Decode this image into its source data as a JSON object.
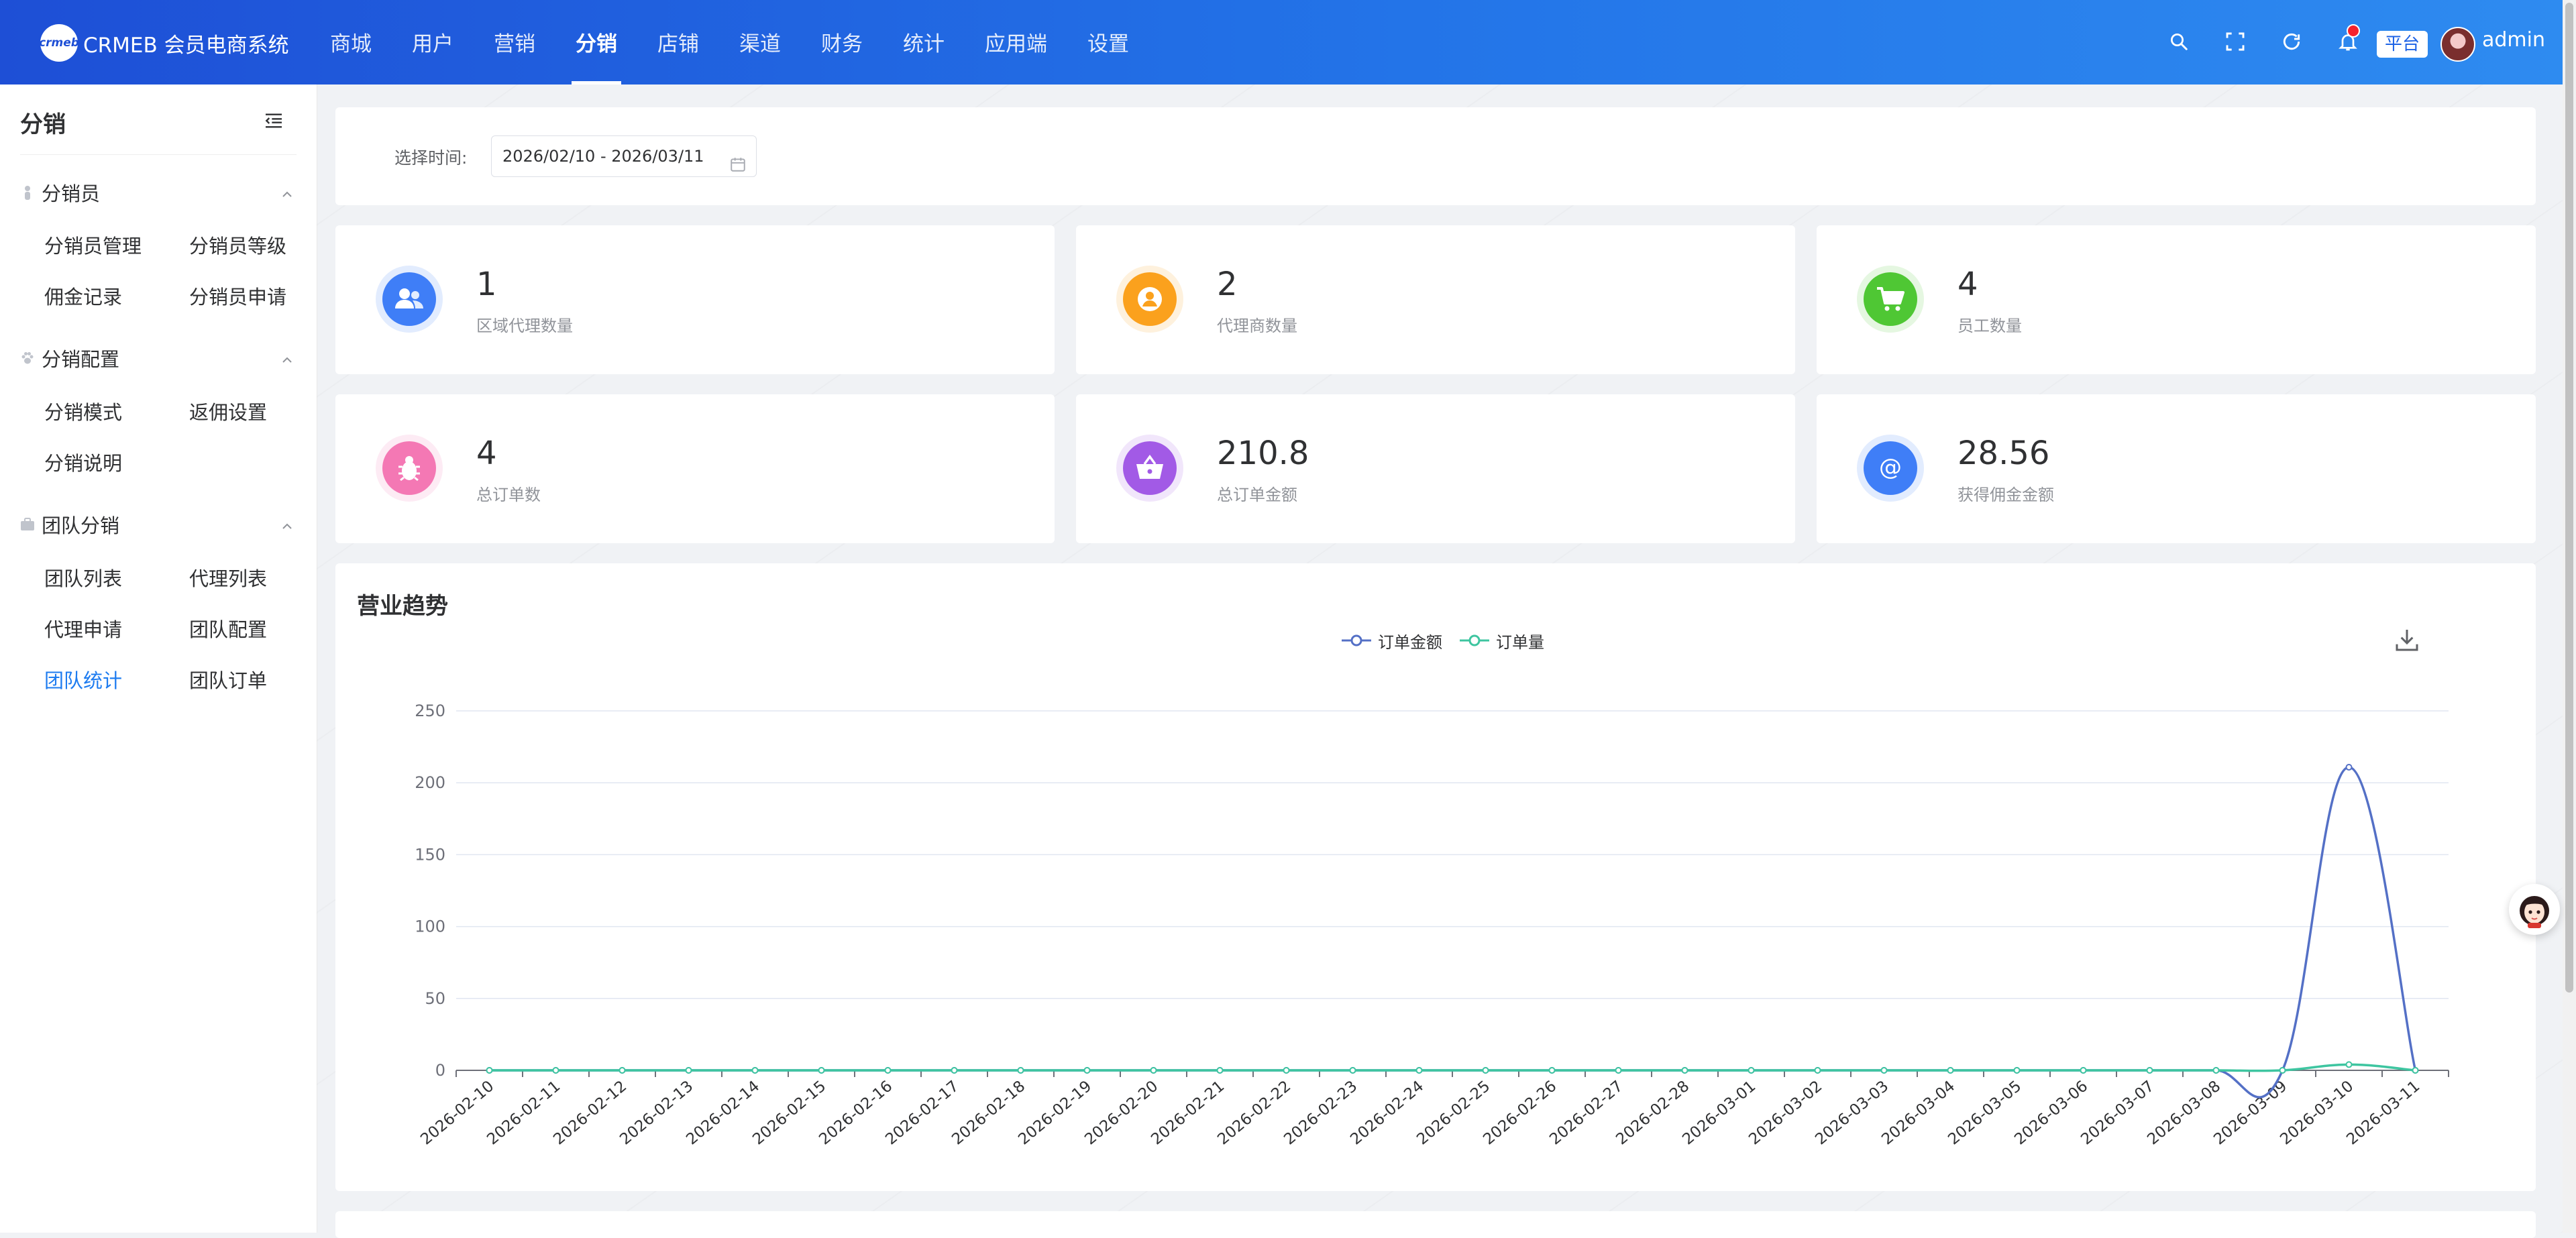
{
  "app": {
    "logo_text": "crmeb",
    "title": "CRMEB 会员电商系统"
  },
  "nav": {
    "items": [
      {
        "label": "商城"
      },
      {
        "label": "用户"
      },
      {
        "label": "营销"
      },
      {
        "label": "分销",
        "active": true
      },
      {
        "label": "店铺"
      },
      {
        "label": "渠道"
      },
      {
        "label": "财务"
      },
      {
        "label": "统计"
      },
      {
        "label": "应用端"
      },
      {
        "label": "设置"
      }
    ],
    "platform_tag": "平台",
    "username": "admin",
    "icons": [
      "search-icon",
      "fullscreen-icon",
      "refresh-icon",
      "bell-icon"
    ],
    "notification_dot_color": "#f5222d"
  },
  "sidebar": {
    "title": "分销",
    "groups": [
      {
        "label": "分销员",
        "icon": "user-icon",
        "items": [
          "分销员管理",
          "分销员等级",
          "佣金记录",
          "分销员申请"
        ]
      },
      {
        "label": "分销配置",
        "icon": "paw-icon",
        "items": [
          "分销模式",
          "返佣设置",
          "分销说明"
        ]
      },
      {
        "label": "团队分销",
        "icon": "briefcase-icon",
        "items": [
          "团队列表",
          "代理列表",
          "代理申请",
          "团队配置",
          "团队统计",
          "团队订单"
        ]
      }
    ],
    "active_item": "团队统计",
    "accent_color": "#1e7cf0"
  },
  "filter": {
    "label": "选择时间:",
    "date_range": "2026/02/10 - 2026/03/11"
  },
  "stats": [
    {
      "value": "1",
      "label": "区域代理数量",
      "color": "#3f7ef7",
      "icon": "users-icon"
    },
    {
      "value": "2",
      "label": "代理商数量",
      "color": "#fba11d",
      "icon": "person-icon"
    },
    {
      "value": "4",
      "label": "员工数量",
      "color": "#4fc734",
      "icon": "cart-icon"
    },
    {
      "value": "4",
      "label": "总订单数",
      "color": "#f478b4",
      "icon": "bug-icon"
    },
    {
      "value": "210.8",
      "label": "总订单金额",
      "color": "#a25ae6",
      "icon": "basket-icon"
    },
    {
      "value": "28.56",
      "label": "获得佣金金额",
      "color": "#3f7ef7",
      "icon": "at-icon"
    }
  ],
  "chart": {
    "title": "营业趋势",
    "legend": [
      {
        "name": "订单金额",
        "color": "#5470c6"
      },
      {
        "name": "订单量",
        "color": "#3ec5a0"
      }
    ]
  },
  "chart_data": {
    "type": "line",
    "x": [
      "2026-02-10",
      "2026-02-11",
      "2026-02-12",
      "2026-02-13",
      "2026-02-14",
      "2026-02-15",
      "2026-02-16",
      "2026-02-17",
      "2026-02-18",
      "2026-02-19",
      "2026-02-20",
      "2026-02-21",
      "2026-02-22",
      "2026-02-23",
      "2026-02-24",
      "2026-02-25",
      "2026-02-26",
      "2026-02-27",
      "2026-02-28",
      "2026-03-01",
      "2026-03-02",
      "2026-03-03",
      "2026-03-04",
      "2026-03-05",
      "2026-03-06",
      "2026-03-07",
      "2026-03-08",
      "2026-03-09",
      "2026-03-10",
      "2026-03-11"
    ],
    "series": [
      {
        "name": "订单金额",
        "values": [
          0,
          0,
          0,
          0,
          0,
          0,
          0,
          0,
          0,
          0,
          0,
          0,
          0,
          0,
          0,
          0,
          0,
          0,
          0,
          0,
          0,
          0,
          0,
          0,
          0,
          0,
          0,
          0,
          210.8,
          0
        ]
      },
      {
        "name": "订单量",
        "values": [
          0,
          0,
          0,
          0,
          0,
          0,
          0,
          0,
          0,
          0,
          0,
          0,
          0,
          0,
          0,
          0,
          0,
          0,
          0,
          0,
          0,
          0,
          0,
          0,
          0,
          0,
          0,
          0,
          4,
          0
        ]
      }
    ],
    "ylim": [
      0,
      250
    ],
    "yticks": [
      0,
      50,
      100,
      150,
      200,
      250
    ],
    "grid": true,
    "legend_position": "top-center"
  }
}
